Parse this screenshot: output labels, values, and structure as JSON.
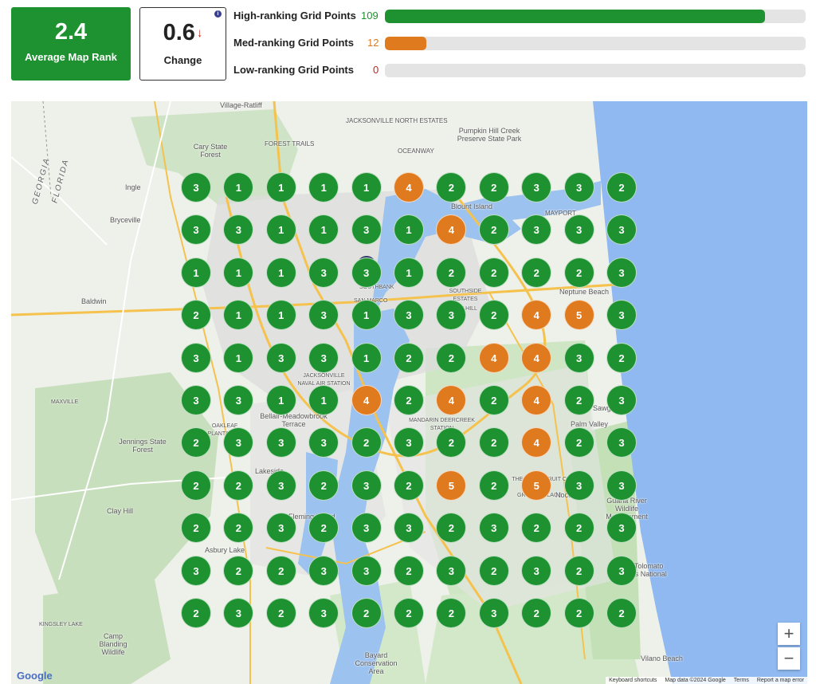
{
  "summary": {
    "average_rank": "2.4",
    "average_rank_label": "Average Map Rank",
    "change_value": "0.6",
    "change_label": "Change",
    "change_arrow": "↓",
    "info_icon": "i"
  },
  "stats": [
    {
      "label": "High-ranking Grid Points",
      "count": "109",
      "fill_fraction": 0.903,
      "color": "#1e9230"
    },
    {
      "label": "Med-ranking Grid Points",
      "count": "12",
      "fill_fraction": 0.099,
      "color": "#e07a1f"
    },
    {
      "label": "Low-ranking Grid Points",
      "count": "0",
      "fill_fraction": 0,
      "color": "#c0261f"
    }
  ],
  "colors": {
    "high": "#1e9230",
    "med": "#e07a1f",
    "low": "#c0261f"
  },
  "grid": [
    [
      "3",
      "1",
      "1",
      "1",
      "1",
      "4",
      "2",
      "2",
      "3",
      "3",
      "2"
    ],
    [
      "3",
      "3",
      "1",
      "1",
      "3",
      "1",
      "4",
      "2",
      "3",
      "3",
      "3"
    ],
    [
      "1",
      "1",
      "1",
      "3",
      "3",
      "1",
      "2",
      "2",
      "2",
      "2",
      "3"
    ],
    [
      "2",
      "1",
      "1",
      "3",
      "1",
      "3",
      "3",
      "2",
      "4",
      "5",
      "3"
    ],
    [
      "3",
      "1",
      "3",
      "3",
      "1",
      "2",
      "2",
      "4",
      "4",
      "3",
      "2"
    ],
    [
      "3",
      "3",
      "1",
      "1",
      "4",
      "2",
      "4",
      "2",
      "4",
      "2",
      "3"
    ],
    [
      "2",
      "3",
      "3",
      "3",
      "2",
      "3",
      "2",
      "2",
      "4",
      "2",
      "3"
    ],
    [
      "2",
      "2",
      "3",
      "2",
      "3",
      "2",
      "5",
      "2",
      "5",
      "3",
      "3"
    ],
    [
      "2",
      "2",
      "3",
      "2",
      "3",
      "3",
      "2",
      "3",
      "2",
      "2",
      "3"
    ],
    [
      "3",
      "2",
      "2",
      "3",
      "3",
      "2",
      "3",
      "2",
      "3",
      "2",
      "3"
    ],
    [
      "2",
      "3",
      "2",
      "3",
      "2",
      "2",
      "2",
      "3",
      "2",
      "2",
      "2"
    ]
  ],
  "map": {
    "places": [
      "Village-Ratliff",
      "JACKSONVILLE NORTH ESTATES",
      "Pumpkin Hill Creek Preserve State Park",
      "Cary State Forest",
      "FOREST TRAILS",
      "OCEANWAY",
      "Ingle",
      "Blount Island",
      "MAYPORT",
      "Bryceville",
      "Baldwin",
      "SOUTHBANK",
      "SAN MARCO",
      "SOUTHSIDE ESTATES",
      "WINDY HILL",
      "Neptune Beach",
      "JACKSONVILLE NAVAL AIR STATION",
      "Bellair-Meadowbrook Terrace",
      "MANDARIN DEERCREEK STATION",
      "Sawgr",
      "Palm Valley",
      "MAXVILLE",
      "Jennings State Forest",
      "OAKLEAF PLANTATION",
      "Lakeside",
      "THE PALMS FRUIT COVE",
      "GREEN VILLAGE",
      "Noco",
      "Guana River Wildlife Management",
      "Clay Hill",
      "Fleming Island",
      "Asbury Lake",
      "Guana Tolomato Matanzas National",
      "KINGSLEY LAKE",
      "Camp Blanding Wildlife",
      "Bayard Conservation Area",
      "Vilano Beach",
      "GEORGIA",
      "FLORIDA"
    ],
    "zoom_in": "+",
    "zoom_out": "−",
    "google_logo": "Google",
    "attribution": [
      "Keyboard shortcuts",
      "Map data ©2024 Google",
      "Terms",
      "Report a map error"
    ]
  }
}
